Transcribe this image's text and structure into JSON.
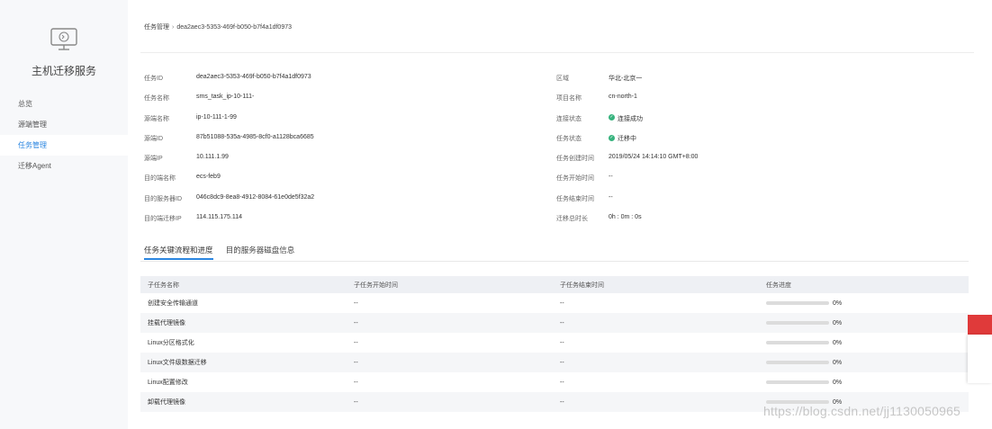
{
  "sidebar": {
    "title": "主机迁移服务",
    "items": [
      {
        "label": "总览",
        "active": false
      },
      {
        "label": "源端管理",
        "active": false
      },
      {
        "label": "任务管理",
        "active": true
      },
      {
        "label": "迁移Agent",
        "active": false
      }
    ]
  },
  "breadcrumb": {
    "root": "任务管理",
    "separator": "›",
    "current": "dea2aec3-5353-469f-b050-b7f4a1df0973"
  },
  "info_left": [
    {
      "label": "任务ID",
      "value": "dea2aec3-5353-469f-b050-b7f4a1df0973"
    },
    {
      "label": "任务名称",
      "value": "sms_task_ip-10-111-"
    },
    {
      "label": "源端名称",
      "value": "ip-10-111-1-99"
    },
    {
      "label": "源端ID",
      "value": "87b51088-535a-4985-8cf0-a1128bca6685"
    },
    {
      "label": "源端IP",
      "value": "10.111.1.99"
    },
    {
      "label": "目的端名称",
      "value": "ecs-feb9"
    },
    {
      "label": "目的服务器ID",
      "value": "046c8dc9-8ea8-4912-8084-61e0de5f32a2"
    },
    {
      "label": "目的端迁移IP",
      "value": "114.115.175.114"
    }
  ],
  "info_right": [
    {
      "label": "区域",
      "value": "华北-北京一"
    },
    {
      "label": "项目名称",
      "value": "cn-north-1"
    },
    {
      "label": "连接状态",
      "value": "连接成功",
      "status": "success"
    },
    {
      "label": "任务状态",
      "value": "迁移中",
      "status": "running"
    },
    {
      "label": "任务创建时间",
      "value": "2019/05/24 14:14:10 GMT+8:00"
    },
    {
      "label": "任务开始时间",
      "value": "--"
    },
    {
      "label": "任务结束时间",
      "value": "--"
    },
    {
      "label": "迁移总时长",
      "value": "0h : 0m : 0s"
    }
  ],
  "tabs": [
    {
      "label": "任务关键流程和进度",
      "active": true
    },
    {
      "label": "目的服务器磁盘信息",
      "active": false
    }
  ],
  "table": {
    "columns": [
      "子任务名称",
      "子任务开始时间",
      "子任务结束时间",
      "任务进度"
    ],
    "rows": [
      {
        "name": "创建安全传输通道",
        "start": "--",
        "end": "--",
        "progress": 0,
        "progress_label": "0%"
      },
      {
        "name": "挂载代理镜像",
        "start": "--",
        "end": "--",
        "progress": 0,
        "progress_label": "0%"
      },
      {
        "name": "Linux分区格式化",
        "start": "--",
        "end": "--",
        "progress": 0,
        "progress_label": "0%"
      },
      {
        "name": "Linux文件级数据迁移",
        "start": "--",
        "end": "--",
        "progress": 0,
        "progress_label": "0%"
      },
      {
        "name": "Linux配置修改",
        "start": "--",
        "end": "--",
        "progress": 0,
        "progress_label": "0%"
      },
      {
        "name": "卸载代理镜像",
        "start": "--",
        "end": "--",
        "progress": 0,
        "progress_label": "0%"
      }
    ]
  },
  "watermark": "https://blog.csdn.net/jj1130050965",
  "colors": {
    "accent": "#2b86e0",
    "success": "#37b37e",
    "sidebar_bg": "#f7f8fa",
    "header_bg": "#eef0f4",
    "widget_red": "#e03a3a"
  },
  "icons": {
    "logo": "monitor-migration-icon",
    "status": "check-circle-icon"
  }
}
